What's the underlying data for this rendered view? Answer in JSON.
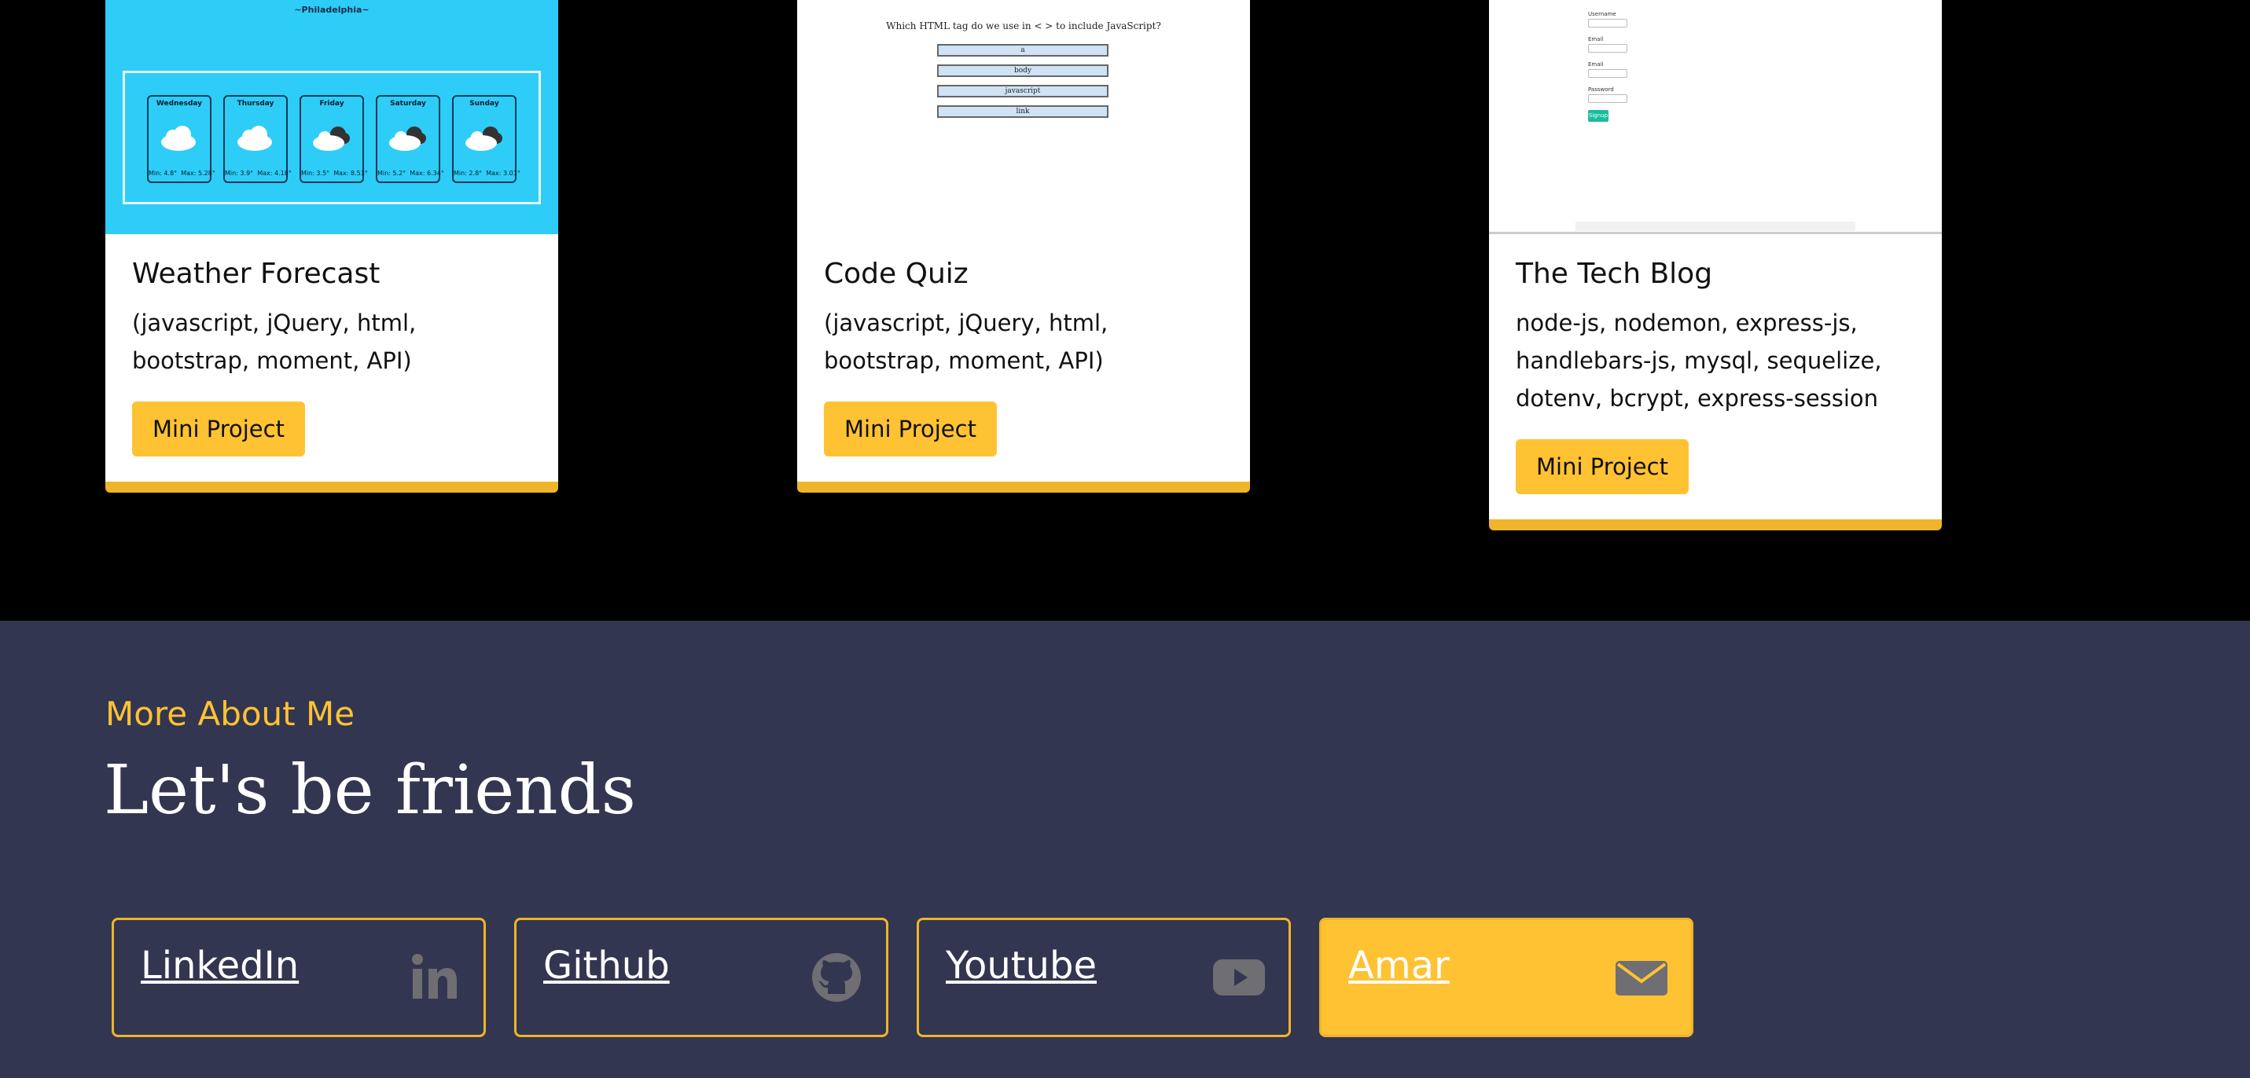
{
  "projects": [
    {
      "title": "Weather Forecast",
      "tech": "(javascript, jQuery, html, bootstrap, moment, API)",
      "button": "Mini Project",
      "thumb": {
        "city": "~Philadelphia~",
        "days": [
          {
            "name": "Wednesday",
            "min": "Min: 4.8°",
            "max": "Max: 5.28°",
            "icon": "cloud-icon"
          },
          {
            "name": "Thursday",
            "min": "Min: 3.9°",
            "max": "Max: 4.18°",
            "icon": "cloud-icon"
          },
          {
            "name": "Friday",
            "min": "Min: 3.5°",
            "max": "Max: 8.53°",
            "icon": "dark-clouds-icon"
          },
          {
            "name": "Saturday",
            "min": "Min: 5.2°",
            "max": "Max: 6.34°",
            "icon": "dark-clouds-icon"
          },
          {
            "name": "Sunday",
            "min": "Min: 2.8°",
            "max": "Max: 3.01°",
            "icon": "dark-clouds-icon"
          }
        ]
      }
    },
    {
      "title": "Code Quiz",
      "tech": "(javascript, jQuery, html, bootstrap, moment, API)",
      "button": "Mini Project",
      "thumb": {
        "question": "Which HTML tag do we use in < > to include JavaScript?",
        "options": [
          "a",
          "body",
          "javascript",
          "link"
        ]
      }
    },
    {
      "title": "The Tech Blog",
      "tech": "node-js, nodemon, express-js, handlebars-js, mysql, sequelize, dotenv, bcrypt, express-session",
      "button": "Mini Project",
      "thumb": {
        "fields": [
          "Username",
          "Email",
          "Email",
          "Password"
        ],
        "submit": "Signup"
      }
    }
  ],
  "footer": {
    "eyebrow": "More About Me",
    "headline": "Let's be friends",
    "links": [
      {
        "label": "LinkedIn",
        "icon": "linkedin-icon"
      },
      {
        "label": "Github",
        "icon": "github-icon"
      },
      {
        "label": "Youtube",
        "icon": "youtube-icon"
      },
      {
        "label": "Amar",
        "icon": "envelope-icon"
      }
    ]
  },
  "colors": {
    "accent": "#ffc233",
    "footer_bg": "#323650",
    "weather_bg": "#2dcdf7",
    "icon_gray": "#6e6e73"
  }
}
